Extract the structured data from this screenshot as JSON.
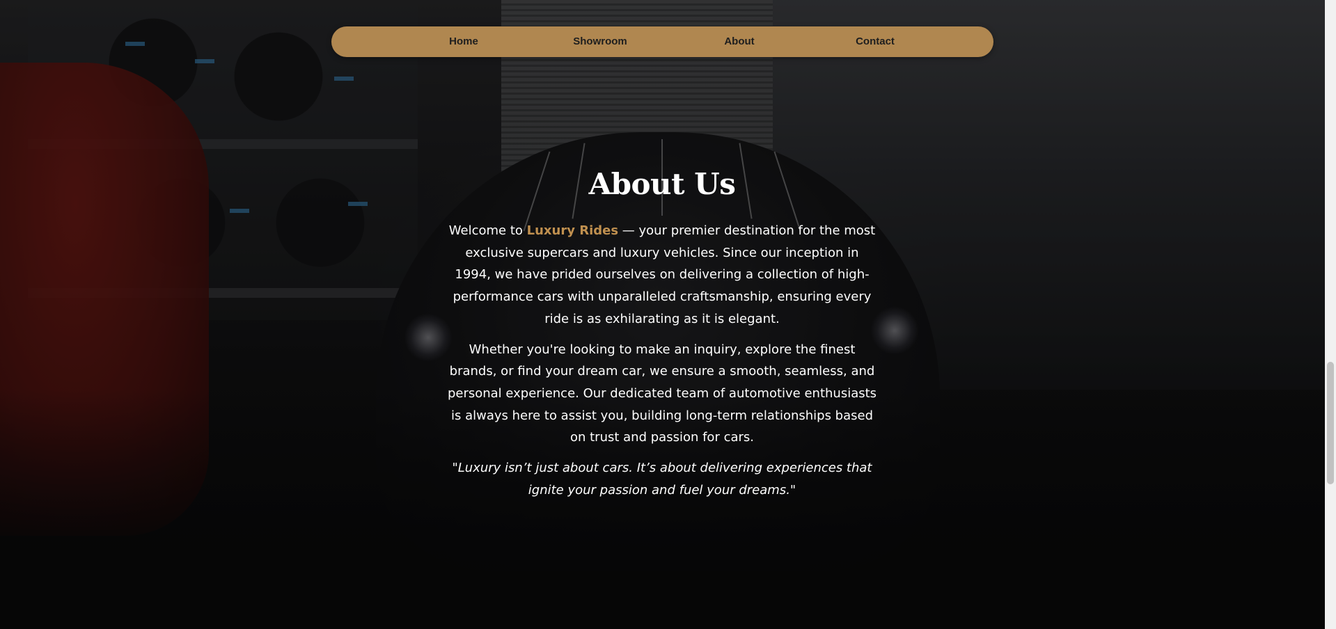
{
  "nav": {
    "items": [
      {
        "label": "Home"
      },
      {
        "label": "Showroom"
      },
      {
        "label": "About"
      },
      {
        "label": "Contact"
      }
    ]
  },
  "about": {
    "title": "About Us",
    "intro_prefix": "Welcome to ",
    "brand": "Luxury Rides",
    "intro_suffix": " — your premier destination for the most exclusive supercars and luxury vehicles. Since our inception in 1994, we have prided ourselves on delivering a collection of high-performance cars with unparalleled craftsmanship, ensuring every ride is as exhilarating as it is elegant.",
    "paragraph2": "Whether you're looking to make an inquiry, explore the finest brands, or find your dream car, we ensure a smooth, seamless, and personal experience. Our dedicated team of automotive enthusiasts is always here to assist you, building long-term relationships based on trust and passion for cars.",
    "quote": "\"Luxury isn’t just about cars. It’s about delivering experiences that ignite your passion and fuel your dreams.\""
  },
  "colors": {
    "accent": "#b08750",
    "brand_text": "#c0904f"
  },
  "scrollbar": {
    "scroll_position": 0.63
  }
}
